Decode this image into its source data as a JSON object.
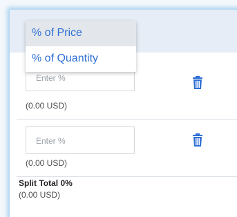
{
  "dropdown": {
    "options": [
      {
        "label": "% of Price",
        "selected": true
      },
      {
        "label": "% of Quantity",
        "selected": false
      }
    ]
  },
  "rows": [
    {
      "input_placeholder": "Enter %",
      "usd": "(0.00 USD)"
    },
    {
      "input_placeholder": "Enter %",
      "usd": "(0.00 USD)"
    }
  ],
  "split": {
    "title": "Split Total 0%",
    "usd": "(0.00 USD)"
  },
  "colors": {
    "accent": "#2f6fd6",
    "header": "#e6edf6",
    "glow": "#5fafeb"
  },
  "icons": {
    "delete": "trash-icon"
  }
}
